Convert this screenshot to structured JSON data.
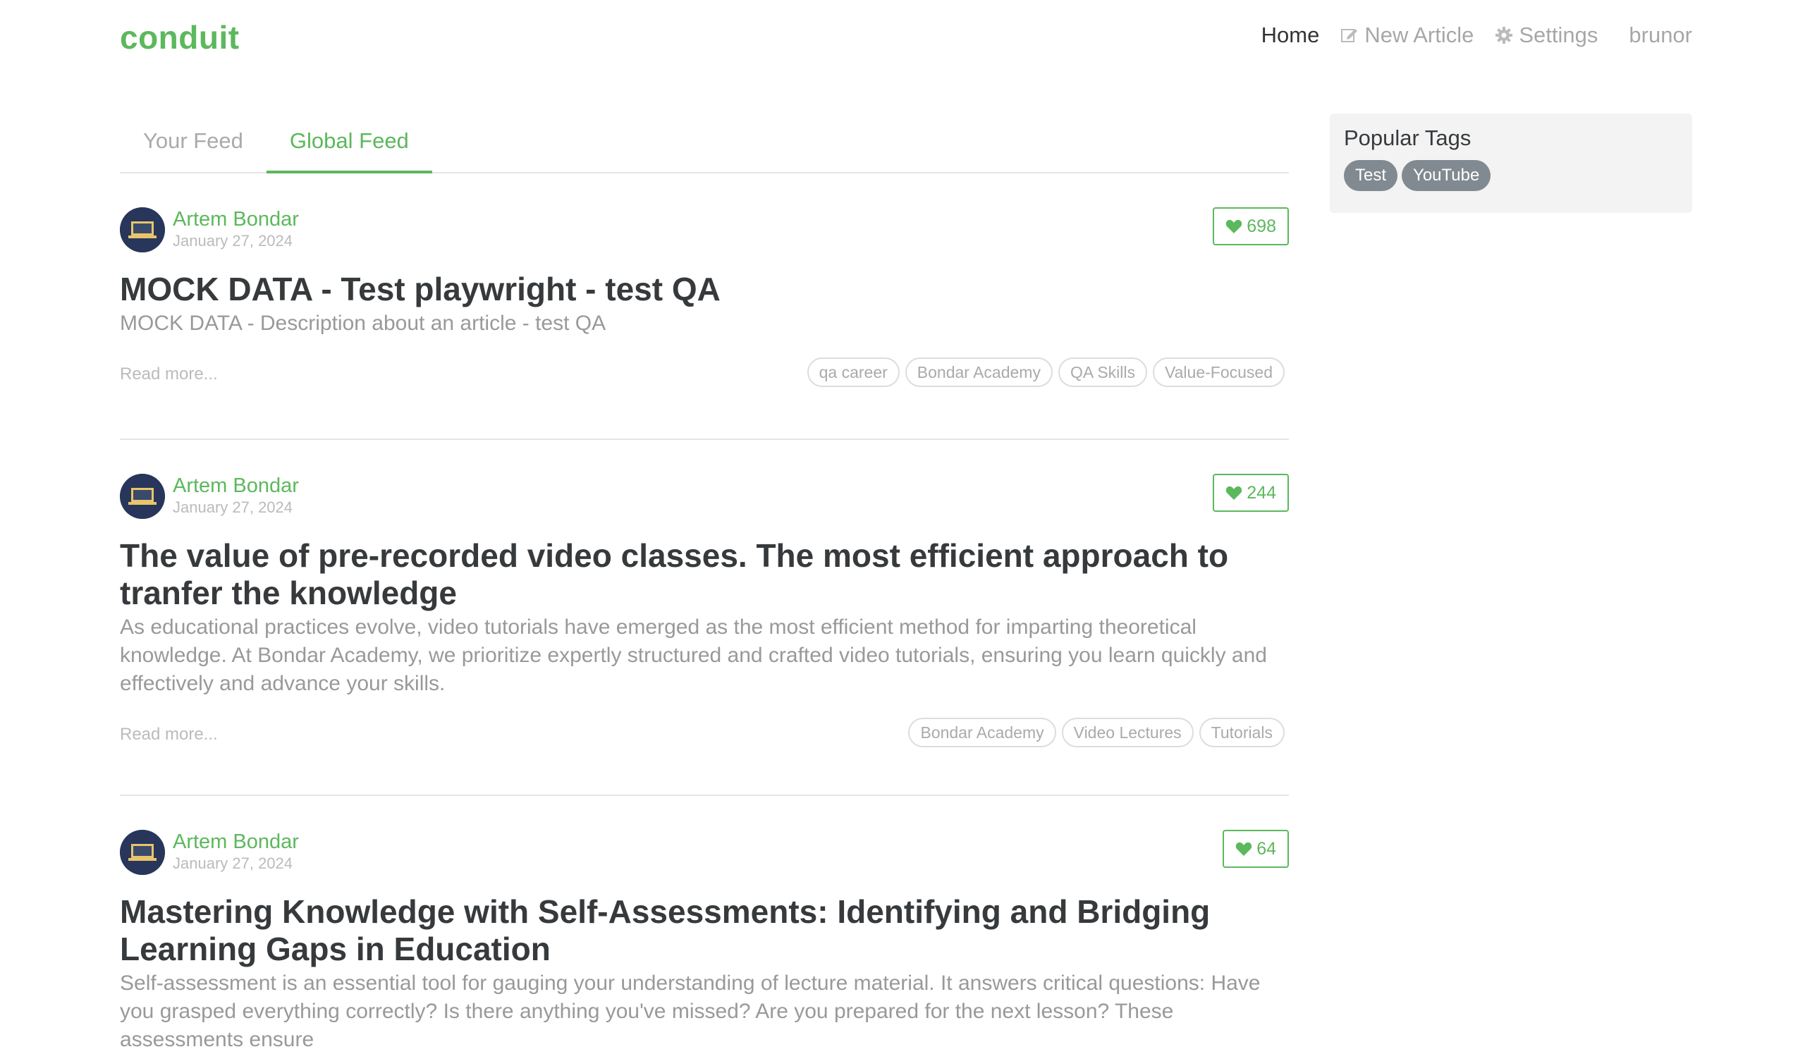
{
  "nav": {
    "brand": "conduit",
    "home": "Home",
    "new_article": "New Article",
    "settings": "Settings",
    "user": "brunor"
  },
  "feed": {
    "tabs": [
      "Your Feed",
      "Global Feed"
    ],
    "active_tab": "Global Feed"
  },
  "articles": [
    {
      "author": "Artem Bondar",
      "date": "January 27, 2024",
      "likes": "698",
      "title": "MOCK DATA - Test playwright - test QA",
      "description": "MOCK DATA - Description about an article - test QA",
      "read_more": "Read more...",
      "tags": [
        "qa career",
        "Bondar Academy",
        "QA Skills",
        "Value-Focused"
      ]
    },
    {
      "author": "Artem Bondar",
      "date": "January 27, 2024",
      "likes": "244",
      "title": "The value of pre-recorded video classes. The most efficient approach to tranfer the knowledge",
      "description": "As educational practices evolve, video tutorials have emerged as the most efficient method for imparting theoretical knowledge. At Bondar Academy, we prioritize expertly structured and crafted video tutorials, ensuring you learn quickly and effectively and advance your skills.",
      "read_more": "Read more...",
      "tags": [
        "Bondar Academy",
        "Video Lectures",
        "Tutorials"
      ]
    },
    {
      "author": "Artem Bondar",
      "date": "January 27, 2024",
      "likes": "64",
      "title": "Mastering Knowledge with Self-Assessments: Identifying and Bridging Learning Gaps in Education",
      "description": "Self-assessment is an essential tool for gauging your understanding of lecture material. It answers critical questions: Have you grasped everything correctly? Is there anything you've missed? Are you prepared for the next lesson? These assessments ensure"
    }
  ],
  "sidebar": {
    "title": "Popular Tags",
    "tags": [
      "Test",
      "YouTube"
    ]
  },
  "colors": {
    "accent": "#5cb85c",
    "tag_pill": "#818a91",
    "sidebar_bg": "#f3f3f3"
  }
}
